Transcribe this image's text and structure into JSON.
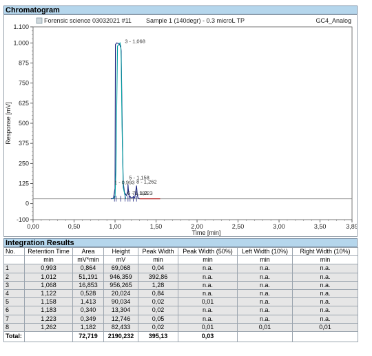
{
  "chromatogram": {
    "section_title": "Chromatogram",
    "header_left": "Forensic science 03032021 #11",
    "header_mid": "Sample 1 (140degr) - 0.3 microL TP",
    "header_right": "GC4_Analog"
  },
  "chart_data": {
    "type": "line",
    "xlabel": "Time [min]",
    "ylabel": "Response [mV]",
    "xlim": [
      0.0,
      3.89
    ],
    "ylim": [
      -100,
      1100
    ],
    "x_ticks": [
      "0,00",
      "0,50",
      "1,00",
      "1,50",
      "2,00",
      "2,50",
      "3,00",
      "3,50",
      "3,89"
    ],
    "y_ticks": [
      "1.100",
      "1.000",
      "875",
      "750",
      "625",
      "500",
      "375",
      "250",
      "125",
      "0",
      "-100"
    ],
    "x_tick_values": [
      0.0,
      0.5,
      1.0,
      1.5,
      2.0,
      2.5,
      3.0,
      3.5,
      3.89
    ],
    "y_tick_values": [
      1100,
      1000,
      875,
      750,
      625,
      500,
      375,
      250,
      125,
      0,
      -100
    ],
    "grid": false,
    "legend": "none",
    "baseline_mV": 30,
    "series": [
      {
        "color": "#1a237e",
        "x": [
          0.95,
          0.98,
          1.0,
          1.005,
          1.02,
          1.05,
          1.06,
          1.065,
          1.068,
          1.075,
          1.09,
          1.1,
          1.11,
          1.115,
          1.12,
          1.122,
          1.125,
          1.13,
          1.14,
          1.155,
          1.158,
          1.162,
          1.17,
          1.18,
          1.183,
          1.19,
          1.2,
          1.215,
          1.223,
          1.23,
          1.24,
          1.255,
          1.262,
          1.27,
          1.28,
          1.3
        ],
        "y": [
          30,
          32,
          95,
          990,
          1000,
          995,
          985,
          975,
          985,
          950,
          400,
          130,
          90,
          70,
          60,
          58,
          62,
          56,
          50,
          80,
          120,
          90,
          50,
          38,
          44,
          40,
          35,
          38,
          44,
          40,
          35,
          88,
          112,
          60,
          35,
          30
        ]
      },
      {
        "color": "#00a0a0",
        "x": [
          0.97,
          1.0,
          1.01,
          1.03,
          1.06,
          1.07,
          1.075,
          1.085,
          1.1,
          1.13
        ],
        "y": [
          30,
          40,
          200,
          980,
          1000,
          970,
          900,
          500,
          100,
          30
        ]
      },
      {
        "color": "#b71c1c",
        "x": [
          1.3,
          1.55
        ],
        "y": [
          30,
          30
        ]
      }
    ],
    "annotations": [
      {
        "text": "3 - 1,068",
        "x": 1.12,
        "y": 1000
      },
      {
        "text": "1 - 0,993",
        "x": 0.99,
        "y": 120
      },
      {
        "text": "5 - 1,158",
        "x": 1.17,
        "y": 150
      },
      {
        "text": "8 - 1,262",
        "x": 1.26,
        "y": 125
      },
      {
        "text": "6 - 1,183",
        "x": 1.15,
        "y": 55
      },
      {
        "text": "7 - 1,223",
        "x": 1.21,
        "y": 55
      }
    ]
  },
  "integration": {
    "section_title": "Integration Results",
    "columns": [
      {
        "name": "No.",
        "unit": ""
      },
      {
        "name": "Retention Time",
        "unit": "min"
      },
      {
        "name": "Area",
        "unit": "mV*min"
      },
      {
        "name": "Height",
        "unit": "mV"
      },
      {
        "name": "Peak Width",
        "unit": "min"
      },
      {
        "name": "Peak Width (50%)",
        "unit": "min"
      },
      {
        "name": "Left Width (10%)",
        "unit": "min"
      },
      {
        "name": "Right Width (10%)",
        "unit": "min"
      }
    ],
    "rows": [
      [
        "1",
        "0,993",
        "0,864",
        "69,068",
        "0,04",
        "n.a.",
        "n.a.",
        "n.a."
      ],
      [
        "2",
        "1,012",
        "51,191",
        "946,359",
        "392,86",
        "n.a.",
        "n.a.",
        "n.a."
      ],
      [
        "3",
        "1,068",
        "16,853",
        "956,265",
        "1,28",
        "n.a.",
        "n.a.",
        "n.a."
      ],
      [
        "4",
        "1,122",
        "0,528",
        "20,024",
        "0,84",
        "n.a.",
        "n.a.",
        "n.a."
      ],
      [
        "5",
        "1,158",
        "1,413",
        "90,034",
        "0,02",
        "0,01",
        "n.a.",
        "n.a."
      ],
      [
        "6",
        "1,183",
        "0,340",
        "13,304",
        "0,02",
        "n.a.",
        "n.a.",
        "n.a."
      ],
      [
        "7",
        "1,223",
        "0,349",
        "12,746",
        "0,05",
        "n.a.",
        "n.a.",
        "n.a."
      ],
      [
        "8",
        "1,262",
        "1,182",
        "82,433",
        "0,02",
        "0,01",
        "0,01",
        "0,01"
      ]
    ],
    "total": [
      "Total:",
      "",
      "72,719",
      "2190,232",
      "395,13",
      "0,03",
      "",
      ""
    ]
  }
}
